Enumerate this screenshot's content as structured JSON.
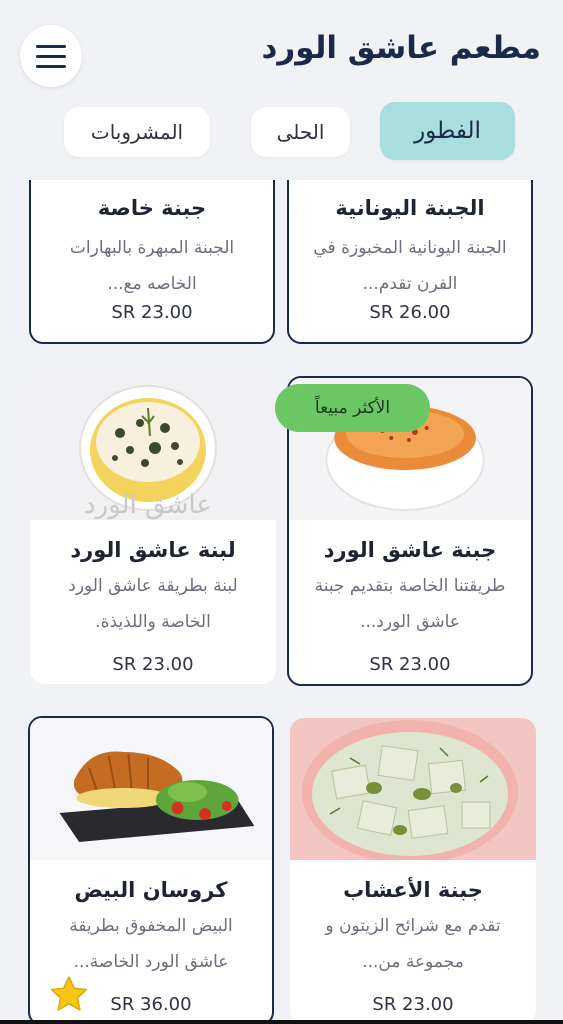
{
  "header": {
    "title": "مطعم عاشق الورد",
    "menu_icon": "hamburger-menu-icon"
  },
  "tabs": [
    {
      "label": "الفطور",
      "active": true
    },
    {
      "label": "الحلى",
      "active": false
    },
    {
      "label": "المشروبات",
      "active": false
    }
  ],
  "products": [
    {
      "name": "جبنة خاصة",
      "desc_line1": "الجبنة المبهرة بالبهارات",
      "desc_line2": "الخاصه مع...",
      "price": "SR 23.00"
    },
    {
      "name": "الجبنة اليونانية",
      "desc_line1": "الجبنة اليونانية المخبوزة في",
      "desc_line2": "الفرن تقدم...",
      "price": "SR 26.00"
    },
    {
      "name": "لبنة عاشق الورد",
      "desc_line1": "لبنة بطريقة عاشق الورد",
      "desc_line2": "الخاصة واللذيذة.",
      "price": "SR 23.00",
      "image_watermark": "عاشق الورد"
    },
    {
      "name": "جبنة عاشق الورد",
      "desc_line1": "طريقتنا الخاصة بتقديم جبنة",
      "desc_line2": "عاشق الورد...",
      "price": "SR 23.00",
      "badge": "الأكثر مبيعاً"
    },
    {
      "name": "كروسان البيض",
      "desc_line1": "البيض المخفوق بطريقة",
      "desc_line2": "عاشق الورد الخاصة...",
      "price": "SR 36.00",
      "icon": "star-icon"
    },
    {
      "name": "جبنة الأعشاب",
      "desc_line1": "تقدم مع شرائح الزيتون و",
      "desc_line2": "مجموعة من...",
      "price": "SR 23.00"
    }
  ],
  "colors": {
    "primary_navy": "#1c2a4a",
    "active_tab": "#a9dede",
    "badge_green": "#6bc664",
    "star_yellow": "#f5c518",
    "background": "#f0f2f6"
  }
}
